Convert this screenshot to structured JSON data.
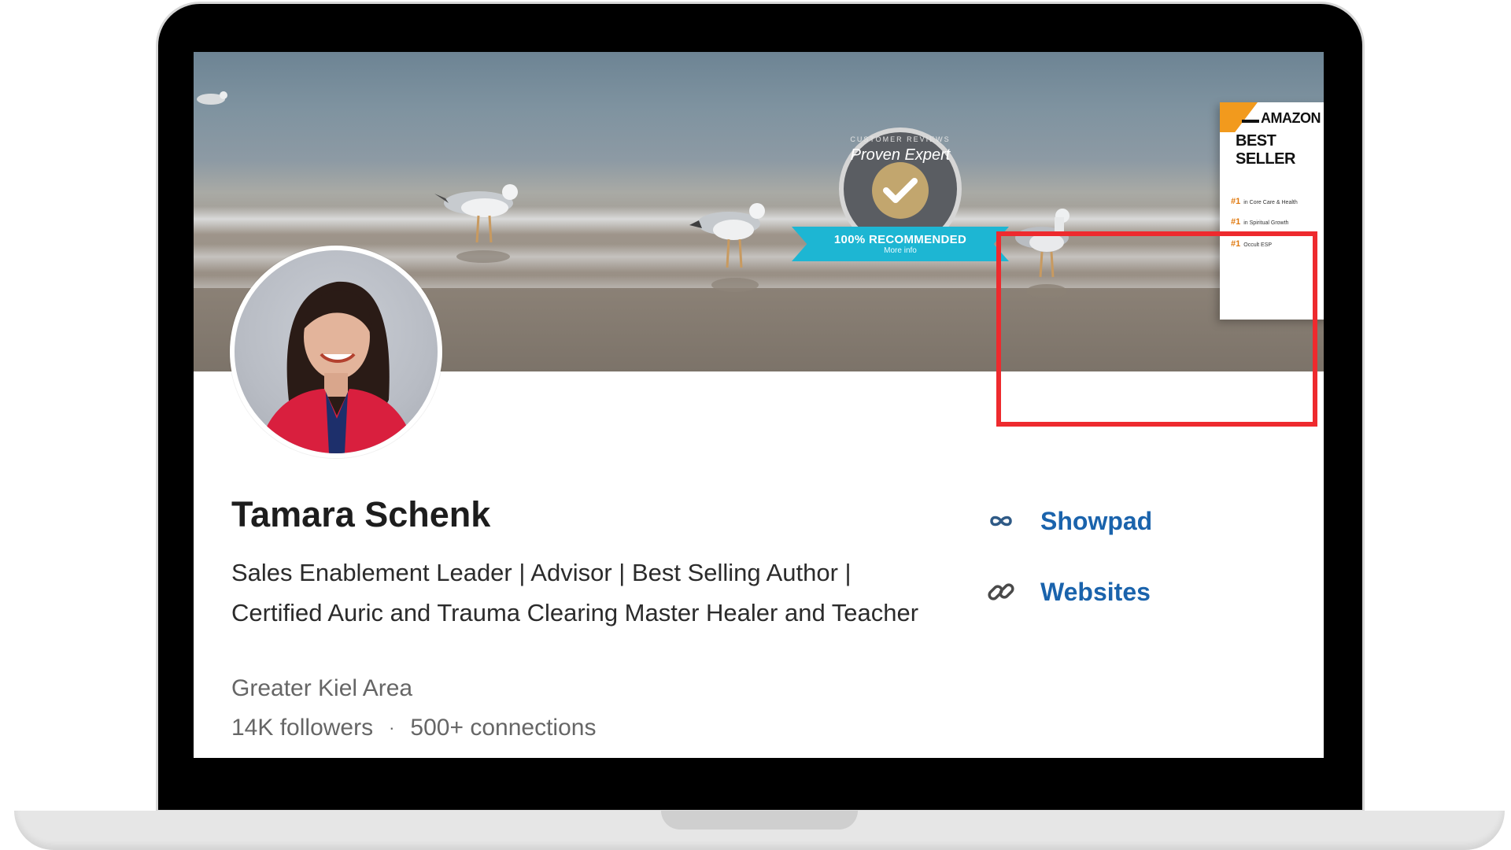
{
  "profile": {
    "name": "Tamara Schenk",
    "headline": "Sales Enablement Leader | Advisor | Best Selling Author | Certified Auric and Trauma Clearing Master Healer and Teacher",
    "location": "Greater Kiel Area",
    "followers": "14K followers",
    "separator": "·",
    "connections": "500+ connections"
  },
  "side_links": [
    {
      "label": "Showpad",
      "icon": "infinity-icon"
    },
    {
      "label": "Websites",
      "icon": "link-icon"
    }
  ],
  "banner": {
    "badge": {
      "arc_text": "CUSTOMER REVIEWS",
      "brand": "Proven Expert",
      "ribbon": "100% RECOMMENDED",
      "ribbon_sub": "More info"
    },
    "book": {
      "title_line1": "AMAZON",
      "title_line2": "BEST SELLER",
      "rows": [
        {
          "rank": "#1",
          "category": "in Core Care & Health"
        },
        {
          "rank": "#1",
          "category": "in Spiritual Growth"
        },
        {
          "rank": "#1",
          "category": "Occult ESP"
        }
      ]
    }
  },
  "colors": {
    "link": "#1a63ac",
    "highlight": "#ee2a2e",
    "badge_ribbon": "#1db6d3"
  }
}
